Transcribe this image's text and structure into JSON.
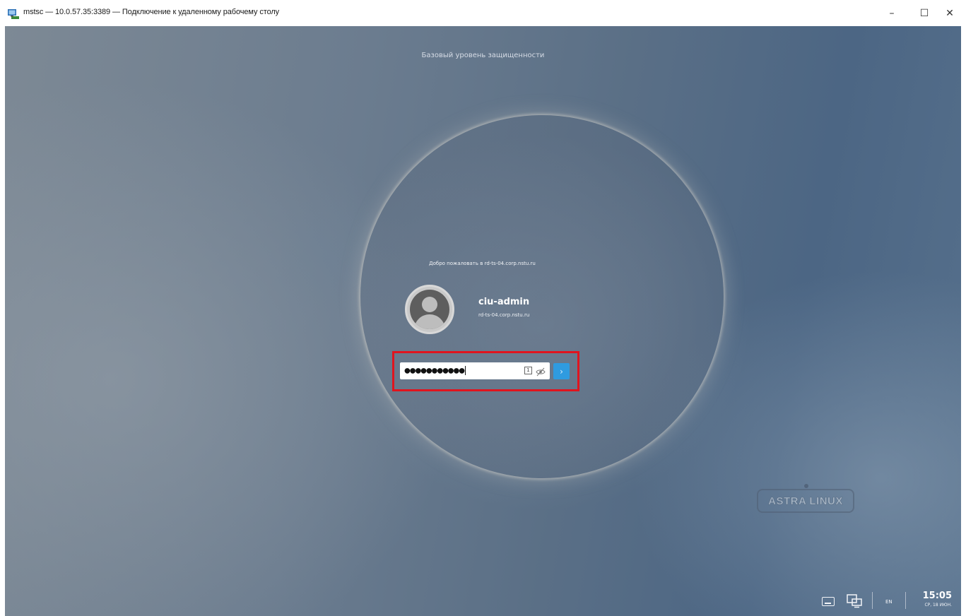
{
  "window": {
    "title": "mstsc — 10.0.57.35:3389 — Подключение к удаленному рабочему столу",
    "controls": {
      "minimize": "–",
      "maximize": "☐",
      "close": "✕"
    }
  },
  "login_screen": {
    "security_level": "Базовый уровень защищенности",
    "welcome": "Добро пожаловать в rd-ts-04.corp.nstu.ru",
    "user": {
      "username": "ciu-admin",
      "host": "rd-ts-04.corp.nstu.ru"
    },
    "password": {
      "masked_value": "●●●●●●●●●●●",
      "keyboard_indicator": "1"
    },
    "submit_glyph": "›",
    "accent_color": "#2f9be0",
    "highlight_color": "#e0141e"
  },
  "tray": {
    "language": "EN",
    "time": "15:05",
    "date": "СР, 18 ИЮН."
  },
  "icons": [
    "app-rdp-icon",
    "eye-slash-icon",
    "keyboard-icon",
    "network-icon",
    "avatar-icon"
  ]
}
